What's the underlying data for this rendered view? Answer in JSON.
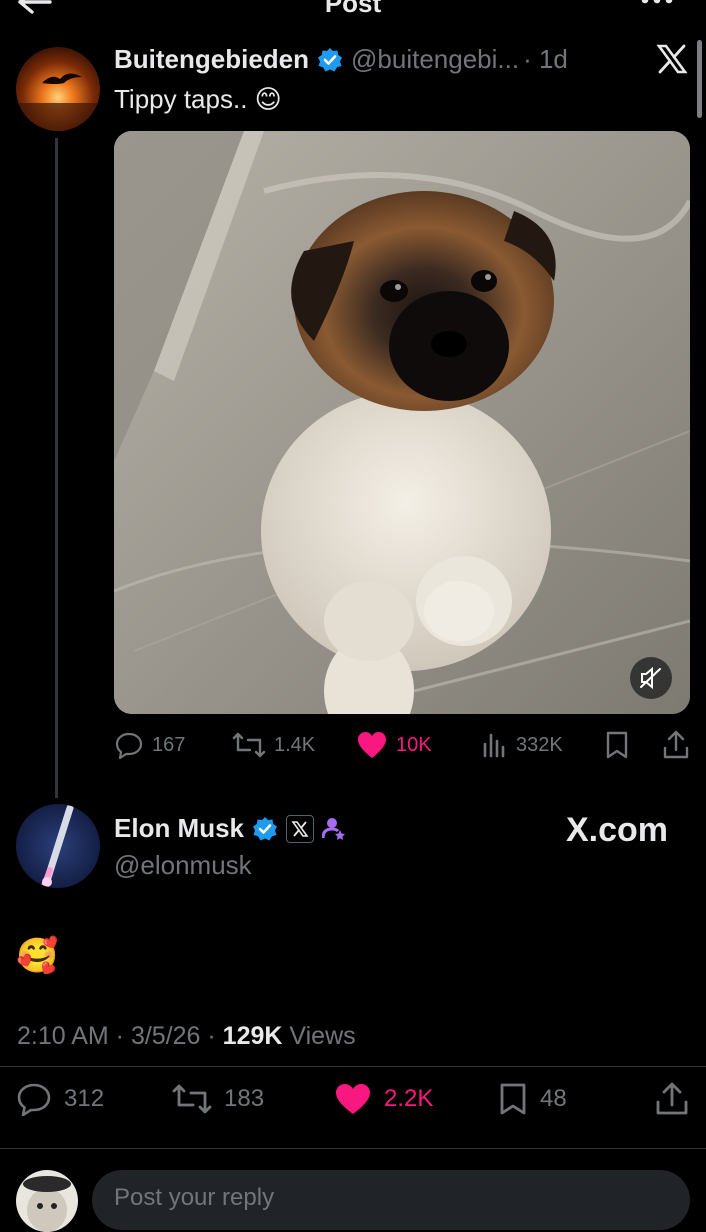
{
  "header": {
    "title": "Post",
    "back_icon": "arrow-left-icon",
    "more_icon": "more-horizontal-icon"
  },
  "tweet": {
    "author_name": "Buitengebieden",
    "handle": "@buitengebi...",
    "time": "· 1d",
    "text": "Tippy taps.. 😊",
    "verified": true,
    "media_alt": "puppy video",
    "stats": {
      "replies": "167",
      "reposts": "1.4K",
      "likes": "10K",
      "views": "332K"
    }
  },
  "reply": {
    "author_name": "Elon Musk",
    "handle": "@elonmusk",
    "text": "🥰",
    "link_label": "X.com",
    "timestamp": "2:10 AM · 3/5/26 · ",
    "views_count": "129K",
    "views_label": " Views",
    "stats": {
      "replies": "312",
      "reposts": "183",
      "likes": "2.2K",
      "bookmarks": "48"
    }
  },
  "composer": {
    "placeholder": "Post your reply"
  },
  "colors": {
    "background": "#000000",
    "text": "#e7e9ea",
    "muted": "#71767b",
    "like": "#f91880",
    "verified": "#1d9bf0"
  }
}
